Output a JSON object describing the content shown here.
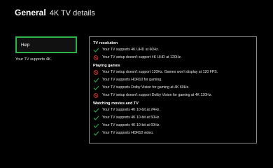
{
  "header": {
    "title": "General",
    "subtitle": "4K TV details"
  },
  "sidebar": {
    "help_label": "Help",
    "supports_text": "Your TV supports 4K."
  },
  "colors": {
    "check": "#2db34a",
    "block": "#d9302b",
    "focus_border": "#2db34a"
  },
  "sections": [
    {
      "title": "TV resolution",
      "items": [
        {
          "status": "check",
          "icon": "check-icon",
          "text": "Your TV supports 4K UHD at 60Hz."
        },
        {
          "status": "block",
          "icon": "blocked-icon",
          "text": "Your TV setup doesn't support 4K UHD at 120Hz."
        }
      ]
    },
    {
      "title": "Playing games",
      "items": [
        {
          "status": "block",
          "icon": "blocked-icon",
          "text": "Your TV setup doesn't support 120Hz. Games won't display at 120 FPS."
        },
        {
          "status": "check",
          "icon": "check-icon",
          "text": "Your TV supports HDR10 for gaming."
        },
        {
          "status": "check",
          "icon": "check-icon",
          "text": "Your TV supports Dolby Vision for gaming at 4K 60Hz."
        },
        {
          "status": "block",
          "icon": "blocked-icon",
          "text": "Your TV setup doesn't support Dolby Vision for gaming at 4K 120Hz."
        }
      ]
    },
    {
      "title": "Watching movies and TV",
      "items": [
        {
          "status": "check",
          "icon": "check-icon",
          "text": "Your TV supports 4K 10-bit at 24Hz."
        },
        {
          "status": "check",
          "icon": "check-icon",
          "text": "Your TV supports 4K 10-bit at 50Hz."
        },
        {
          "status": "check",
          "icon": "check-icon",
          "text": "Your TV supports 4K 10-bit at 60Hz."
        },
        {
          "status": "check",
          "icon": "check-icon",
          "text": "Your TV supports HDR10 video."
        }
      ]
    }
  ]
}
